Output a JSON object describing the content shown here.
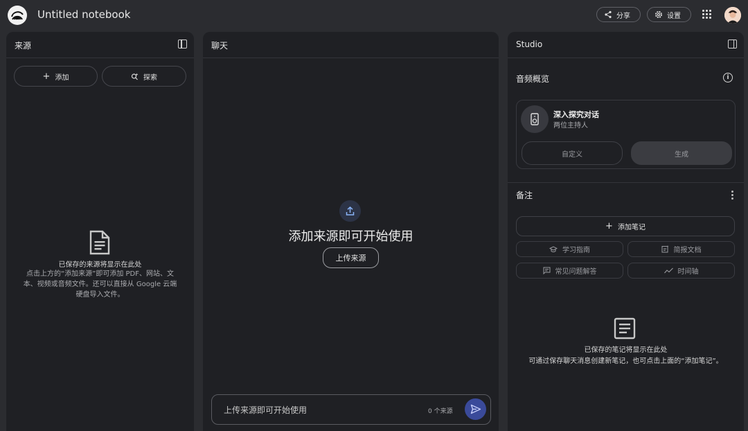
{
  "app": {
    "title": "Untitled notebook"
  },
  "topbar": {
    "share_label": "分享",
    "settings_label": "设置"
  },
  "sources": {
    "title": "来源",
    "add_label": "添加",
    "explore_label": "探索",
    "empty_title": "已保存的来源将显示在此处",
    "empty_desc_1": "点击上方的“添加来源”即可添加 PDF、网站、文",
    "empty_desc_2": "本、视频或音频文件。还可以直接从 Google 云端",
    "empty_desc_3": "硬盘导入文件。"
  },
  "chat": {
    "title": "聊天",
    "empty_heading": "添加来源即可开始使用",
    "upload_label": "上传来源",
    "input_placeholder": "上传来源即可开始使用",
    "source_count": "0 个来源"
  },
  "studio": {
    "title": "Studio",
    "audio_title": "音频概览",
    "deep_dive_title": "深入探究对话",
    "deep_dive_sub": "两位主持人",
    "customize_label": "自定义",
    "generate_label": "生成",
    "notes_title": "备注",
    "add_note_label": "添加笔记",
    "study_guide_label": "学习指南",
    "briefing_label": "简报文档",
    "faq_label": "常见问题解答",
    "timeline_label": "时间轴",
    "notes_empty_title": "已保存的笔记将显示在此处",
    "notes_empty_desc": "可通过保存聊天消息创建新笔记，也可点击上面的“添加笔记”。"
  },
  "icons": {
    "logo": "notebooklm-logo-icon",
    "share": "share-icon",
    "settings": "gear-icon",
    "apps": "apps-grid-icon",
    "upload": "upload-icon",
    "send": "send-icon",
    "info": "info-icon",
    "more": "more-vert-icon",
    "document": "document-icon",
    "note": "note-icon",
    "speaker": "speaker-icon"
  },
  "colors": {
    "background": "#2b2c30",
    "panel": "#1f2024",
    "accent": "#3a4a9a",
    "accent_icon": "#8ab4f8"
  }
}
